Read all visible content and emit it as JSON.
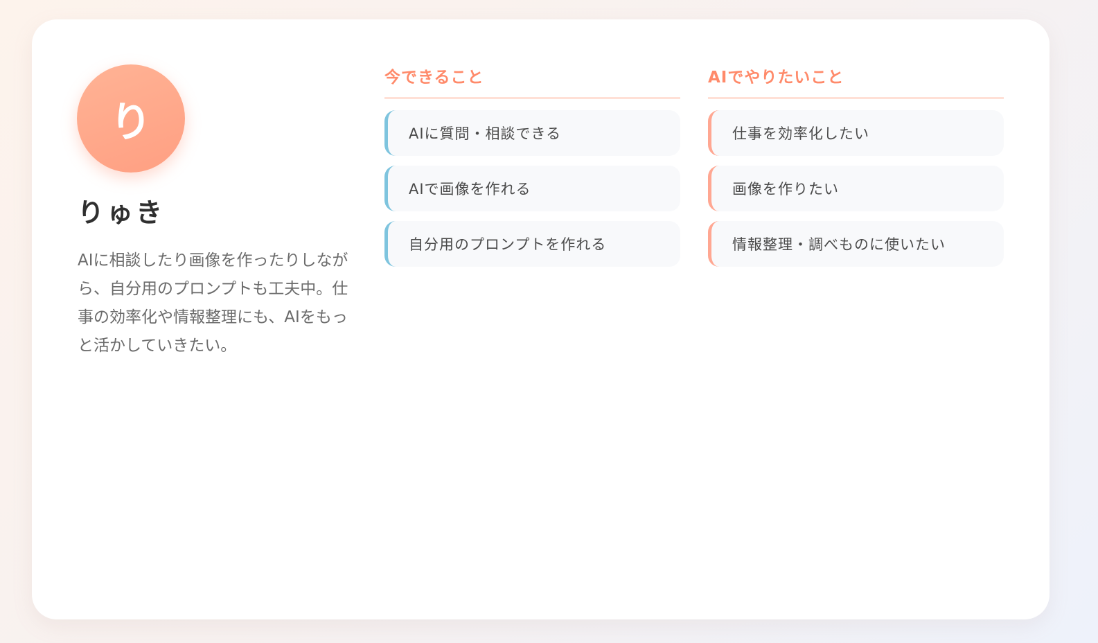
{
  "profile": {
    "avatar_initial": "り",
    "name": "りゅき",
    "bio": "AIに相談したり画像を作ったりしながら、自分用のプロンプトも工夫中。仕事の効率化や情報整理にも、AIをもっと活かしていきたい。"
  },
  "can_do": {
    "heading": "今できること",
    "items": [
      "AIに質問・相談できる",
      "AIで画像を作れる",
      "自分用のプロンプトを作れる"
    ]
  },
  "want_to_do": {
    "heading": "AIでやりたいこと",
    "items": [
      "仕事を効率化したい",
      "画像を作りたい",
      "情報整理・調べものに使いたい"
    ]
  },
  "colors": {
    "accent": "#ff8a6a",
    "can_do_bar": "#7ec4de",
    "want_bar": "#ffa792"
  }
}
